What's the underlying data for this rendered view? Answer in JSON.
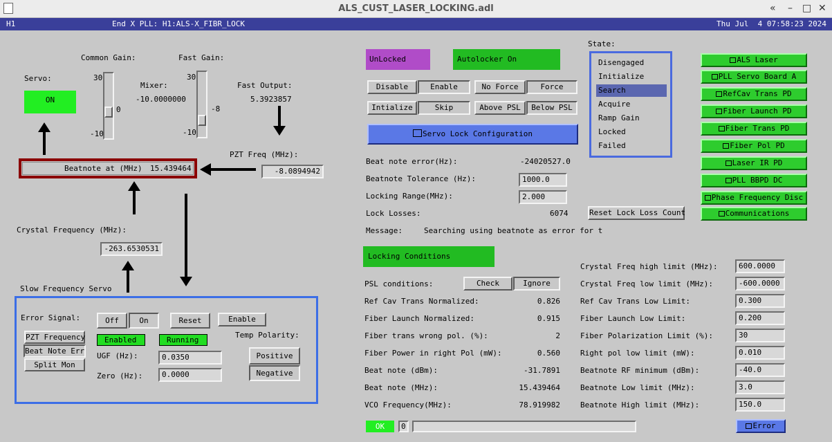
{
  "window": {
    "title": "ALS_CUST_LASER_LOCKING.adl",
    "min": "–",
    "max": "□",
    "restore": "«",
    "close": "✕"
  },
  "header": {
    "ifo": "H1",
    "title": "End X PLL: H1:ALS-X_FIBR_LOCK",
    "datetime": "Thu Jul  4 07:58:23 2024"
  },
  "left": {
    "servo_label": "Servo:",
    "servo_button": "ON",
    "common_gain_label": "Common Gain:",
    "common_gain_max": "30",
    "common_gain_min": "-10",
    "common_gain_value": "0",
    "mixer_label": "Mixer:",
    "mixer_value": "-10.0000000",
    "fast_gain_label": "Fast Gain:",
    "fast_gain_max": "30",
    "fast_gain_min": "-10",
    "fast_gain_value": "-8",
    "fast_output_label": "Fast Output:",
    "fast_output_value": "5.3923857",
    "pzt_freq_label": "PZT Freq (MHz):",
    "pzt_freq_value": "-8.0894942",
    "beatnote_label": "Beatnote at (MHz)",
    "beatnote_value": "15.439464",
    "crystal_label": "Crystal Frequency (MHz):",
    "crystal_value": "-263.6530531",
    "slow_servo_title": "Slow Frequency Servo",
    "error_signal_label": "Error Signal:",
    "error_options": [
      "PZT Frequency",
      "Beat Note Error",
      "Split Mon"
    ],
    "off_label": "Off",
    "on_label": "On",
    "reset_label": "Reset",
    "enable_label": "Enable",
    "enabled_status": "Enabled",
    "running_status": "Running",
    "temp_polarity_label": "Temp Polarity:",
    "positive_label": "Positive",
    "negative_label": "Negative",
    "ugf_label": "UGF (Hz):",
    "ugf_value": "0.0350",
    "zero_label": "Zero (Hz):",
    "zero_value": "0.0000"
  },
  "middle": {
    "unlocked": "UnLocked",
    "autolocker": "Autolocker On",
    "disable": "Disable",
    "enable": "Enable",
    "no_force": "No Force",
    "force": "Force",
    "initialize": "Intialize",
    "skip": "Skip",
    "above_psl": "Above PSL",
    "below_psl": "Below PSL",
    "servo_lock_config": "Servo Lock Configuration",
    "beat_error_label": "Beat note error(Hz):",
    "beat_error_value": "-24020527.0",
    "tolerance_label": "Beatnote Tolerance (Hz):",
    "tolerance_value": "1000.0",
    "locking_range_label": "Locking Range(MHz):",
    "locking_range_value": "2.000",
    "lock_losses_label": "Lock Losses:",
    "lock_losses_value": "6074",
    "reset_lock_loss": "Reset Lock Loss Count",
    "message_label": "Message:",
    "message_value": "Searching using beatnote as error for t"
  },
  "state": {
    "label": "State:",
    "items": [
      "Disengaged",
      "Initialize",
      "Search",
      "Acquire",
      "Ramp Gain",
      "Locked",
      "Failed"
    ],
    "selected": "Search"
  },
  "screens": [
    "ALS Laser",
    "PLL Servo Board A",
    "RefCav Trans PD",
    "Fiber Launch PD",
    "Fiber Trans PD",
    "Fiber Pol PD",
    "Laser IR PD",
    "PLL BBPD DC",
    "Phase Frequency Disc",
    "Communications"
  ],
  "conditions": {
    "title": "Locking Conditions",
    "psl_label": "PSL conditions:",
    "check": "Check",
    "ignore": "Ignore",
    "rows": [
      {
        "label": "Ref Cav Trans Normalized:",
        "value": "0.826"
      },
      {
        "label": "Fiber Launch Normalized:",
        "value": "0.915"
      },
      {
        "label": "Fiber trans wrong pol. (%):",
        "value": "2"
      },
      {
        "label": "Fiber Power in right Pol (mW):",
        "value": "0.560"
      },
      {
        "label": "Beat note (dBm):",
        "value": "-31.7891"
      },
      {
        "label": "Beat note (MHz):",
        "value": "15.439464"
      },
      {
        "label": "VCO Frequency(MHz):",
        "value": "78.919982"
      }
    ],
    "limits": [
      {
        "label": "Crystal Freq high limit (MHz):",
        "value": "600.0000"
      },
      {
        "label": "Crystal Freq low limit (MHz):",
        "value": "-600.0000"
      },
      {
        "label": "Ref Cav Trans Low Limit:",
        "value": "0.300"
      },
      {
        "label": "Fiber Launch Low Limit:",
        "value": "0.200"
      },
      {
        "label": "Fiber Polarization Limit (%):",
        "value": "30"
      },
      {
        "label": "Right pol low limit (mW):",
        "value": "0.010"
      },
      {
        "label": "Beatnote RF minimum (dBm):",
        "value": "-40.0"
      },
      {
        "label": "Beatnote Low limit (MHz):",
        "value": "3.0"
      },
      {
        "label": "Beatnote High limit (MHz):",
        "value": "150.0"
      }
    ]
  },
  "footer": {
    "ok": "OK",
    "count": "0",
    "error_button": "Error"
  },
  "colors": {
    "green": "#2ecc2e",
    "magenta": "#b04cc8",
    "blue_button": "#5a78e6",
    "dark_red": "#8b0000",
    "frame_blue": "#3c6ee6",
    "menubar": "#3a3f9a"
  }
}
